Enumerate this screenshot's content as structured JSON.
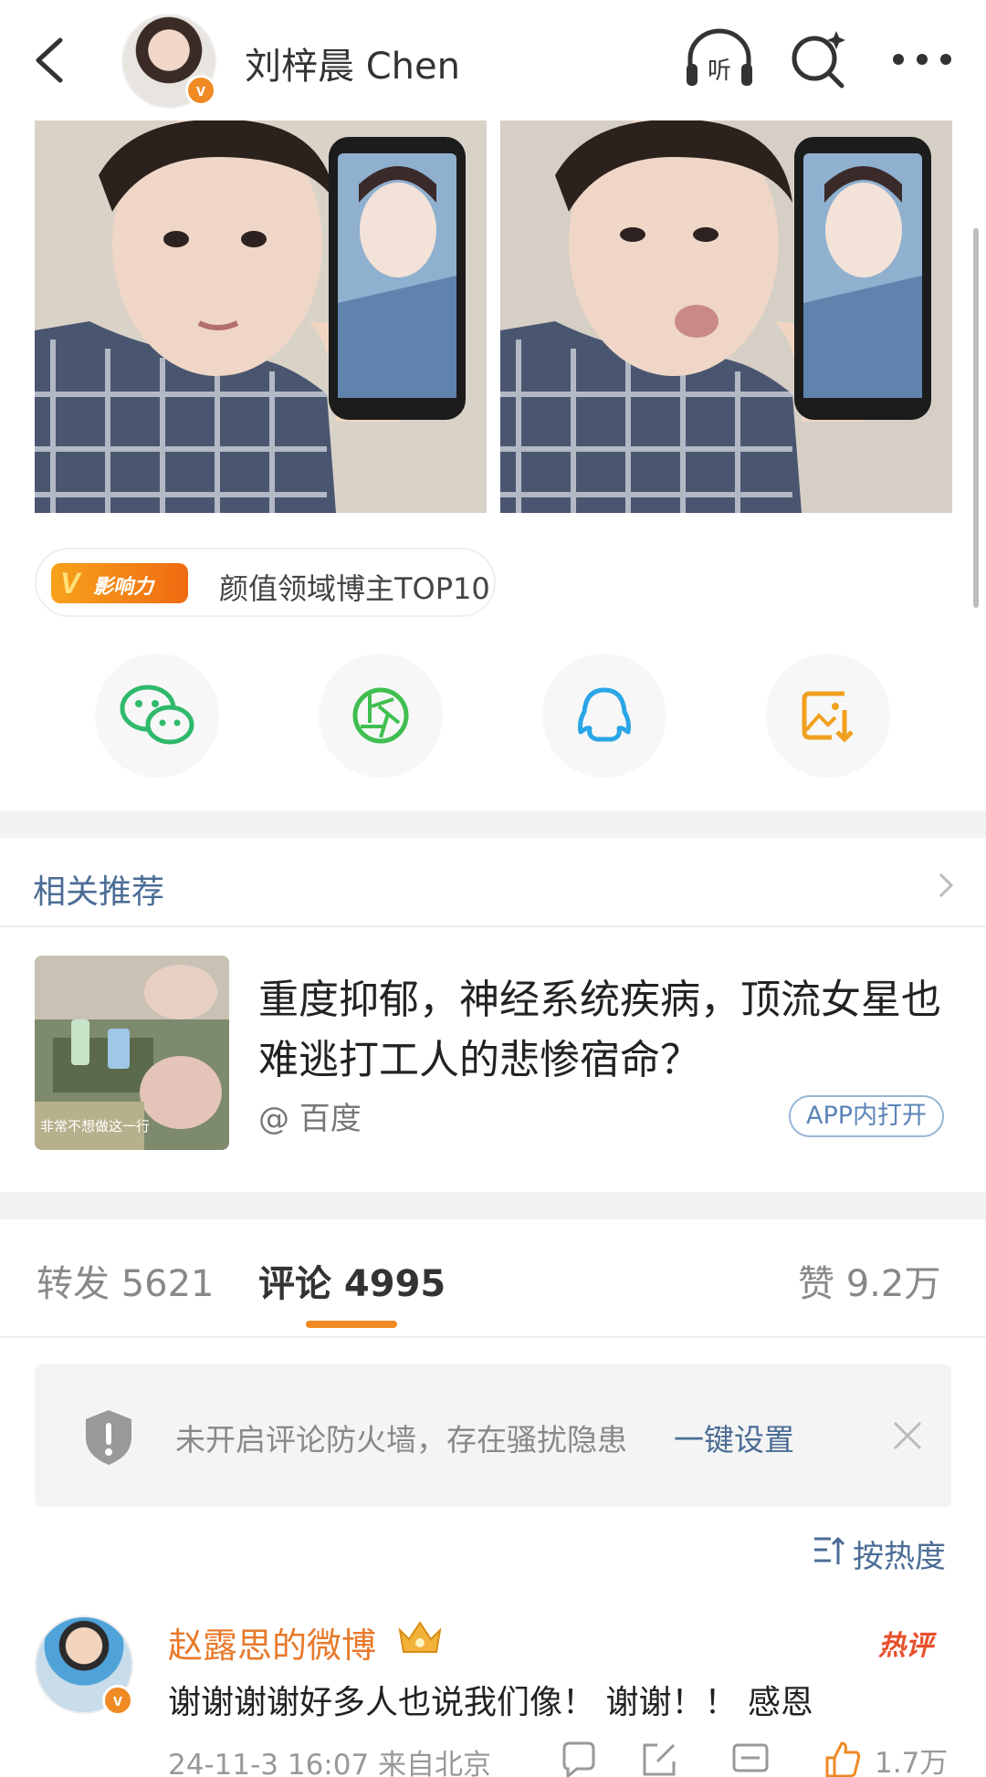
{
  "header": {
    "username": "刘梓晨 Chen",
    "verified_badge": "v",
    "icons": [
      "back-icon",
      "listen-icon",
      "search-icon",
      "more-icon"
    ],
    "listen_label": "听"
  },
  "influence_badge": {
    "badge_v": "V",
    "badge_text": "影响力",
    "text": "颜值领域博主TOP10"
  },
  "share_buttons": [
    {
      "name": "wechat",
      "icon": "wechat-icon",
      "color": "#2fba6b"
    },
    {
      "name": "moments",
      "icon": "moments-icon",
      "color": "#3fbf4f"
    },
    {
      "name": "qq",
      "icon": "qq-icon",
      "color": "#2aa6e6"
    },
    {
      "name": "save-image",
      "icon": "save-image-icon",
      "color": "#f0a020"
    }
  ],
  "related": {
    "title": "相关推荐",
    "headline": "重度抑郁，神经系统疾病，顶流女星也难逃打工人的悲惨宿命？",
    "source": "@ 百度",
    "open_app": "APP内打开",
    "thumb_caption": "非常不想做这一行"
  },
  "tabs": {
    "repost": "转发 5621",
    "comments": "评论 4995",
    "likes": "赞 9.2万"
  },
  "firewall": {
    "text": "未开启评论防火墙，存在骚扰隐患",
    "link": "一键设置"
  },
  "sort": {
    "label": "按热度"
  },
  "comment": {
    "author": "赵露思的微博",
    "hot_label": "热评",
    "text": "谢谢谢谢好多人也说我们像！ 谢谢！！ 感恩",
    "time": "24-11-3 16:07 来自北京",
    "likes": "1.7万"
  },
  "colors": {
    "accent": "#f08a24",
    "link": "#4b6d96",
    "name_orange": "#e8792a"
  }
}
